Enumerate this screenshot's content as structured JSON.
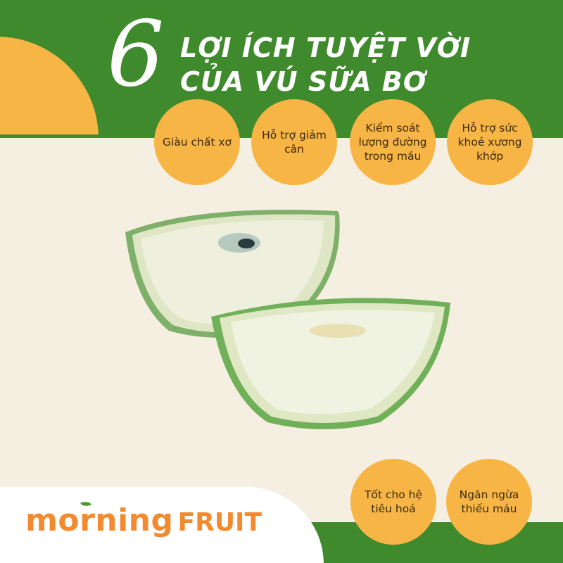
{
  "title": {
    "number": "6",
    "line1": "LỢI ÍCH TUYỆT VỜI",
    "line2": "CỦA VÚ SỮA BƠ"
  },
  "benefits": [
    {
      "text": "Giàu chất xơ"
    },
    {
      "text": "Hỗ trợ giảm cân"
    },
    {
      "text": "Kiểm soát lượng đường trong máu"
    },
    {
      "text": "Hỗ trợ sức khoẻ xương khớp"
    },
    {
      "text": "Tốt cho hệ tiêu hoá"
    },
    {
      "text": "Ngăn ngừa thiếu máu"
    }
  ],
  "brand": {
    "word1": "morning",
    "word2": "FRUIT"
  },
  "colors": {
    "green": "#3e8a2c",
    "orange": "#f7b545",
    "cream": "#f5efe1",
    "logo_orange": "#f28b30"
  }
}
